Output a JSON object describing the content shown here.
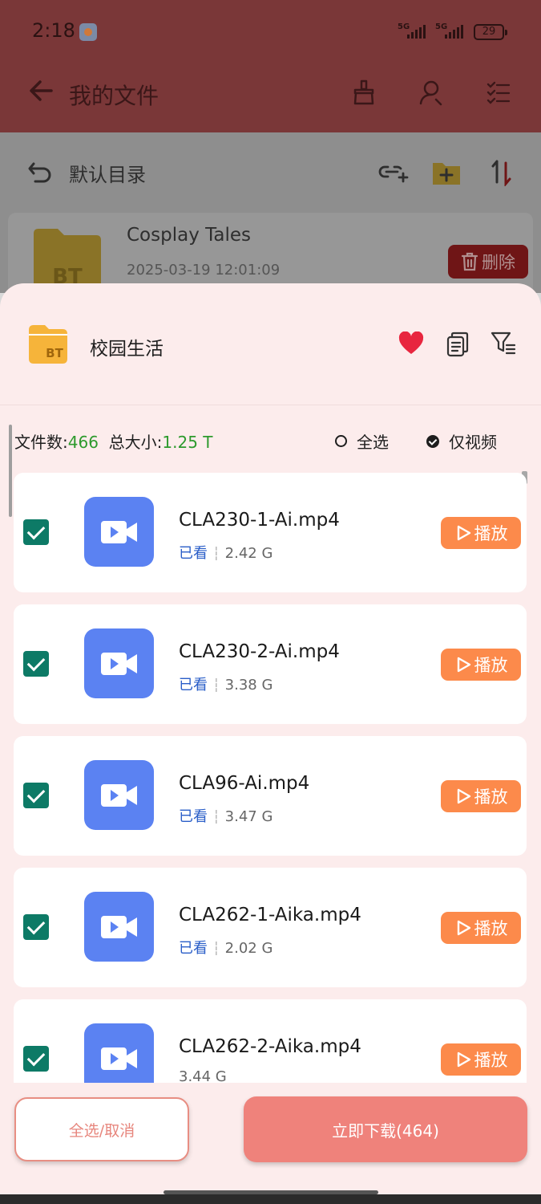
{
  "status_bar": {
    "time": "2:18",
    "network_1": "5G",
    "network_2": "5G",
    "battery": "29"
  },
  "app_bar": {
    "title": "我的文件",
    "icons": [
      "back-arrow-icon",
      "broom-icon",
      "user-search-icon",
      "checklist-icon"
    ]
  },
  "directory": {
    "label": "默认目录",
    "icons": [
      "undo-icon",
      "link-add-icon",
      "folder-add-icon",
      "sort-icon"
    ]
  },
  "background_item": {
    "name": "Cosplay Tales",
    "date": "2025-03-19 12:01:09",
    "folder_tag": "BT",
    "delete_label": "删除"
  },
  "sheet": {
    "folder_tag": "BT",
    "title": "校园生活",
    "icons": [
      "heart-icon",
      "copy-icon",
      "filter-icon"
    ],
    "accent_color": "#e8263f"
  },
  "stats": {
    "files_label": "文件数:",
    "files_count": "466",
    "size_label": "总大小:",
    "size_value": "1.25 T",
    "select_all_label": "全选",
    "video_only_label": "仅视频"
  },
  "files": [
    {
      "name": "CLA230-1-Ai.mp4",
      "seen": "已看",
      "size": "2.42 G",
      "play_label": "播放"
    },
    {
      "name": "CLA230-2-Ai.mp4",
      "seen": "已看",
      "size": "3.38 G",
      "play_label": "播放"
    },
    {
      "name": "CLA96-Ai.mp4",
      "seen": "已看",
      "size": "3.47 G",
      "play_label": "播放"
    },
    {
      "name": "CLA262-1-Aika.mp4",
      "seen": "已看",
      "size": "2.02 G",
      "play_label": "播放"
    },
    {
      "name": "CLA262-2-Aika.mp4",
      "seen": "",
      "size": "3.44 G",
      "play_label": "播放"
    }
  ],
  "actions": {
    "select_toggle_label": "全选/取消",
    "download_label": "立即下载(464)"
  },
  "colors": {
    "checkbox": "#0d7a66",
    "video_tile": "#5b82f2",
    "play_button": "#fc8a4b",
    "download_button": "#ef827b",
    "count_green": "#2d9a2d"
  }
}
